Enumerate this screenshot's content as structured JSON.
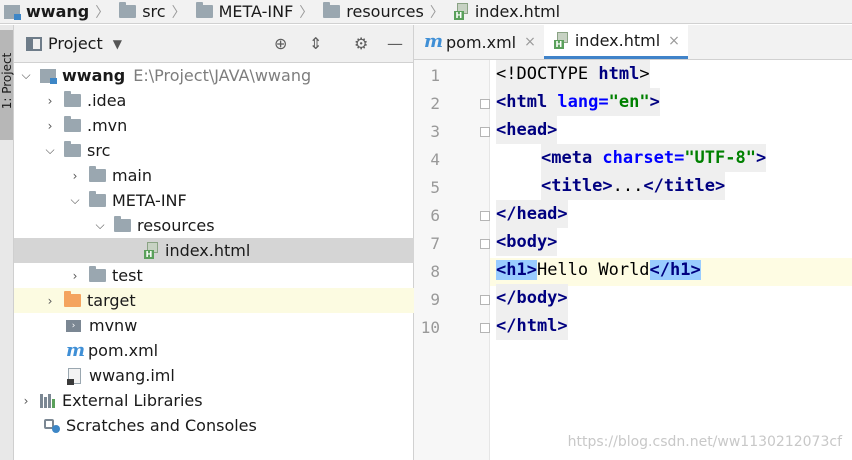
{
  "breadcrumb": {
    "items": [
      "wwang",
      "src",
      "META-INF",
      "resources",
      "index.html"
    ]
  },
  "side_strip": {
    "tab_label": "1: Project"
  },
  "project_panel": {
    "title": "Project",
    "tree": [
      {
        "label": "wwang",
        "path": "E:\\Project\\JAVA\\wwang"
      },
      {
        "label": ".idea"
      },
      {
        "label": ".mvn"
      },
      {
        "label": "src"
      },
      {
        "label": "main"
      },
      {
        "label": "META-INF"
      },
      {
        "label": "resources"
      },
      {
        "label": "index.html"
      },
      {
        "label": "test"
      },
      {
        "label": "target"
      },
      {
        "label": "mvnw"
      },
      {
        "label": "pom.xml"
      },
      {
        "label": "wwang.iml"
      },
      {
        "label": "External Libraries"
      },
      {
        "label": "Scratches and Consoles"
      }
    ]
  },
  "editor": {
    "tabs": [
      {
        "label": "pom.xml",
        "close": "×"
      },
      {
        "label": "index.html",
        "close": "×"
      }
    ],
    "line_numbers": [
      "1",
      "2",
      "3",
      "4",
      "5",
      "6",
      "7",
      "8",
      "9",
      "10"
    ],
    "code": {
      "l1": {
        "a": "<!DOCTYPE ",
        "b": "html",
        "c": ">"
      },
      "l2": {
        "a": "<html ",
        "b": "lang=",
        "c": "\"en\"",
        "d": ">"
      },
      "l3": "<head>",
      "l4": {
        "a": "<meta ",
        "b": "charset=",
        "c": "\"UTF-8\"",
        "d": ">"
      },
      "l5": {
        "a": "<title>",
        "b": "...",
        "c": "</title>"
      },
      "l6": "</head>",
      "l7": "<body>",
      "l8": {
        "a": "<h1>",
        "b": "Hello World",
        "c": "</h1>"
      },
      "l9": "</body>",
      "l10": "</html>"
    }
  },
  "watermark": "https://blog.csdn.net/ww1130212073cf",
  "colors": {
    "accent": "#4083c9",
    "folder": "#9aa7b0",
    "excluded_folder": "#f4a45f",
    "selection": "#d5d5d5",
    "tag": "#000080",
    "string": "#008000"
  }
}
